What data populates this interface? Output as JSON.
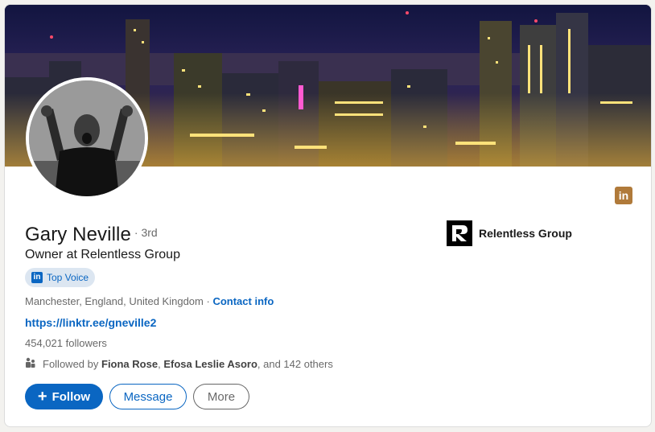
{
  "profile": {
    "name": "Gary Neville",
    "degree": "· 3rd",
    "headline": "Owner at Relentless Group",
    "badge": {
      "label": "Top Voice",
      "icon": "linkedin-icon"
    },
    "location": "Manchester, England, United Kingdom",
    "location_separator": "·",
    "contact_info": "Contact info",
    "website": "https://linktr.ee/gneville2",
    "followers": "454,021 followers",
    "followed_by": {
      "prefix": "Followed by",
      "person1": "Fiona Rose",
      "sep": ",",
      "person2": "Efosa Leslie Asoro",
      "suffix": ", and 142 others"
    }
  },
  "company": {
    "name": "Relentless Group",
    "logo_letter": "R"
  },
  "corner_badge": {
    "text": "in",
    "color": "#b07a3a"
  },
  "actions": {
    "follow": "Follow",
    "follow_icon": "+",
    "message": "Message",
    "more": "More"
  },
  "colors": {
    "primary": "#0a66c2",
    "badge_bg": "#dce6f1"
  }
}
